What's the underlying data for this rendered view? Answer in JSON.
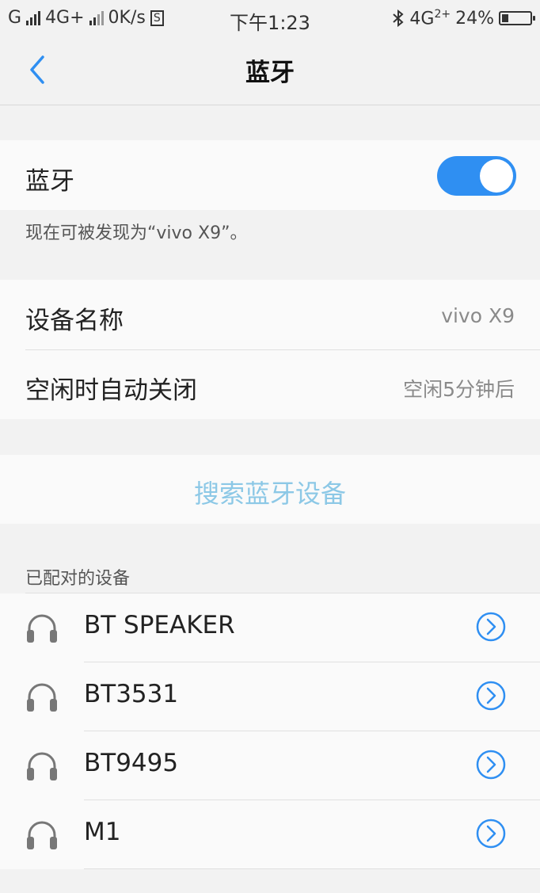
{
  "status_bar": {
    "carrier1": "G",
    "network": "4G+",
    "speed": "0K/s",
    "s_icon": "S",
    "time": "下午1:23",
    "network2": "4G",
    "network2_sub": "2+",
    "battery": "24%",
    "battery_level": 0.24
  },
  "header": {
    "title": "蓝牙"
  },
  "bluetooth": {
    "label": "蓝牙",
    "enabled": true,
    "discoverable_note": "现在可被发现为“vivo X9”。"
  },
  "settings": [
    {
      "label": "设备名称",
      "value": "vivo X9"
    },
    {
      "label": "空闲时自动关闭",
      "value": "空闲5分钟后"
    }
  ],
  "search_button": "搜索蓝牙设备",
  "paired_section": {
    "title": "已配对的设备",
    "devices": [
      {
        "name": "BT SPEAKER",
        "icon": "headphones-icon"
      },
      {
        "name": "BT3531",
        "icon": "headphones-icon"
      },
      {
        "name": "BT9495",
        "icon": "headphones-icon"
      },
      {
        "name": "M1",
        "icon": "headphones-icon"
      }
    ]
  },
  "colors": {
    "accent": "#2f8ff2",
    "search_text": "#8cc8e6",
    "background": "#f2f2f2",
    "card": "#fafafa"
  }
}
